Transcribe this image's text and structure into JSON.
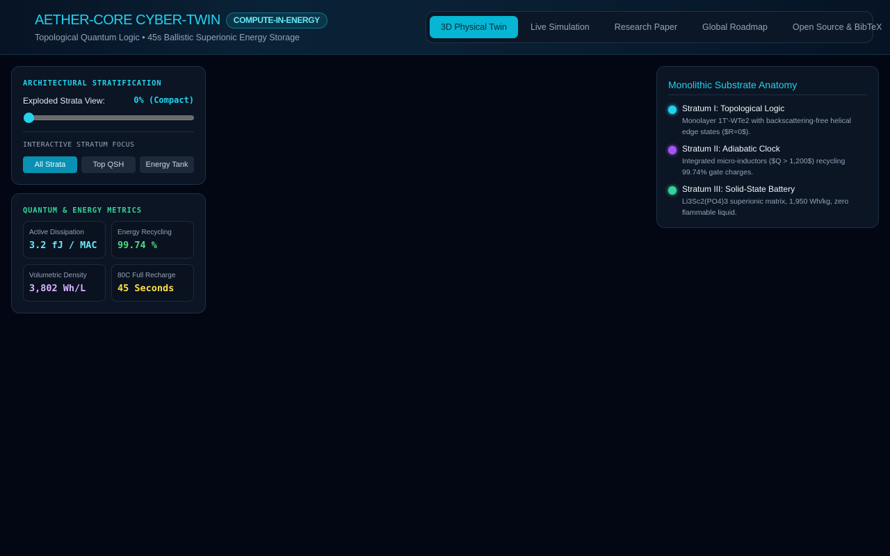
{
  "header": {
    "title": "AETHER-CORE CYBER-TWIN",
    "badge": "COMPUTE-IN-ENERGY",
    "subtitle": "Topological Quantum Logic • 45s Ballistic Superionic Energy Storage"
  },
  "nav": {
    "tabs": [
      {
        "label": "3D Physical Twin",
        "active": true
      },
      {
        "label": "Live Simulation",
        "active": false
      },
      {
        "label": "Research Paper",
        "active": false
      },
      {
        "label": "Global Roadmap",
        "active": false
      },
      {
        "label": "Open Source & BibTeX",
        "active": false
      }
    ]
  },
  "architecture": {
    "title": "ARCHITECTURAL STRATIFICATION",
    "exploded_label": "Exploded Strata View:",
    "exploded_value": "0% (Compact)",
    "exploded_fraction": 0,
    "focus_title": "INTERACTIVE STRATUM FOCUS",
    "focus_buttons": [
      {
        "label": "All Strata",
        "active": true
      },
      {
        "label": "Top QSH",
        "active": false
      },
      {
        "label": "Energy Tank",
        "active": false
      }
    ]
  },
  "metrics": {
    "title": "QUANTUM & ENERGY METRICS",
    "items": [
      {
        "label": "Active Dissipation",
        "value": "3.2 fJ / MAC",
        "color": "#67e8f9"
      },
      {
        "label": "Energy Recycling",
        "value": "99.74 %",
        "color": "#4ade80"
      },
      {
        "label": "Volumetric Density",
        "value": "3,802 Wh/L",
        "color": "#d8b4fe"
      },
      {
        "label": "80C Full Recharge",
        "value": "45 Seconds",
        "color": "#fde047"
      }
    ]
  },
  "anatomy": {
    "title": "Monolithic Substrate Anatomy",
    "strata": [
      {
        "name": "Stratum I: Topological Logic",
        "desc": "Monolayer 1T'-WTe2 with backscattering-free helical edge states ($R=0$).",
        "color": "#22d3ee"
      },
      {
        "name": "Stratum II: Adiabatic Clock",
        "desc": "Integrated micro-inductors ($Q > 1,200$) recycling 99.74% gate charges.",
        "color": "#a855f7"
      },
      {
        "name": "Stratum III: Solid-State Battery",
        "desc": "Li3Sc2(PO4)3 superionic matrix, 1,950 Wh/kg, zero flammable liquid.",
        "color": "#34d399"
      }
    ]
  }
}
